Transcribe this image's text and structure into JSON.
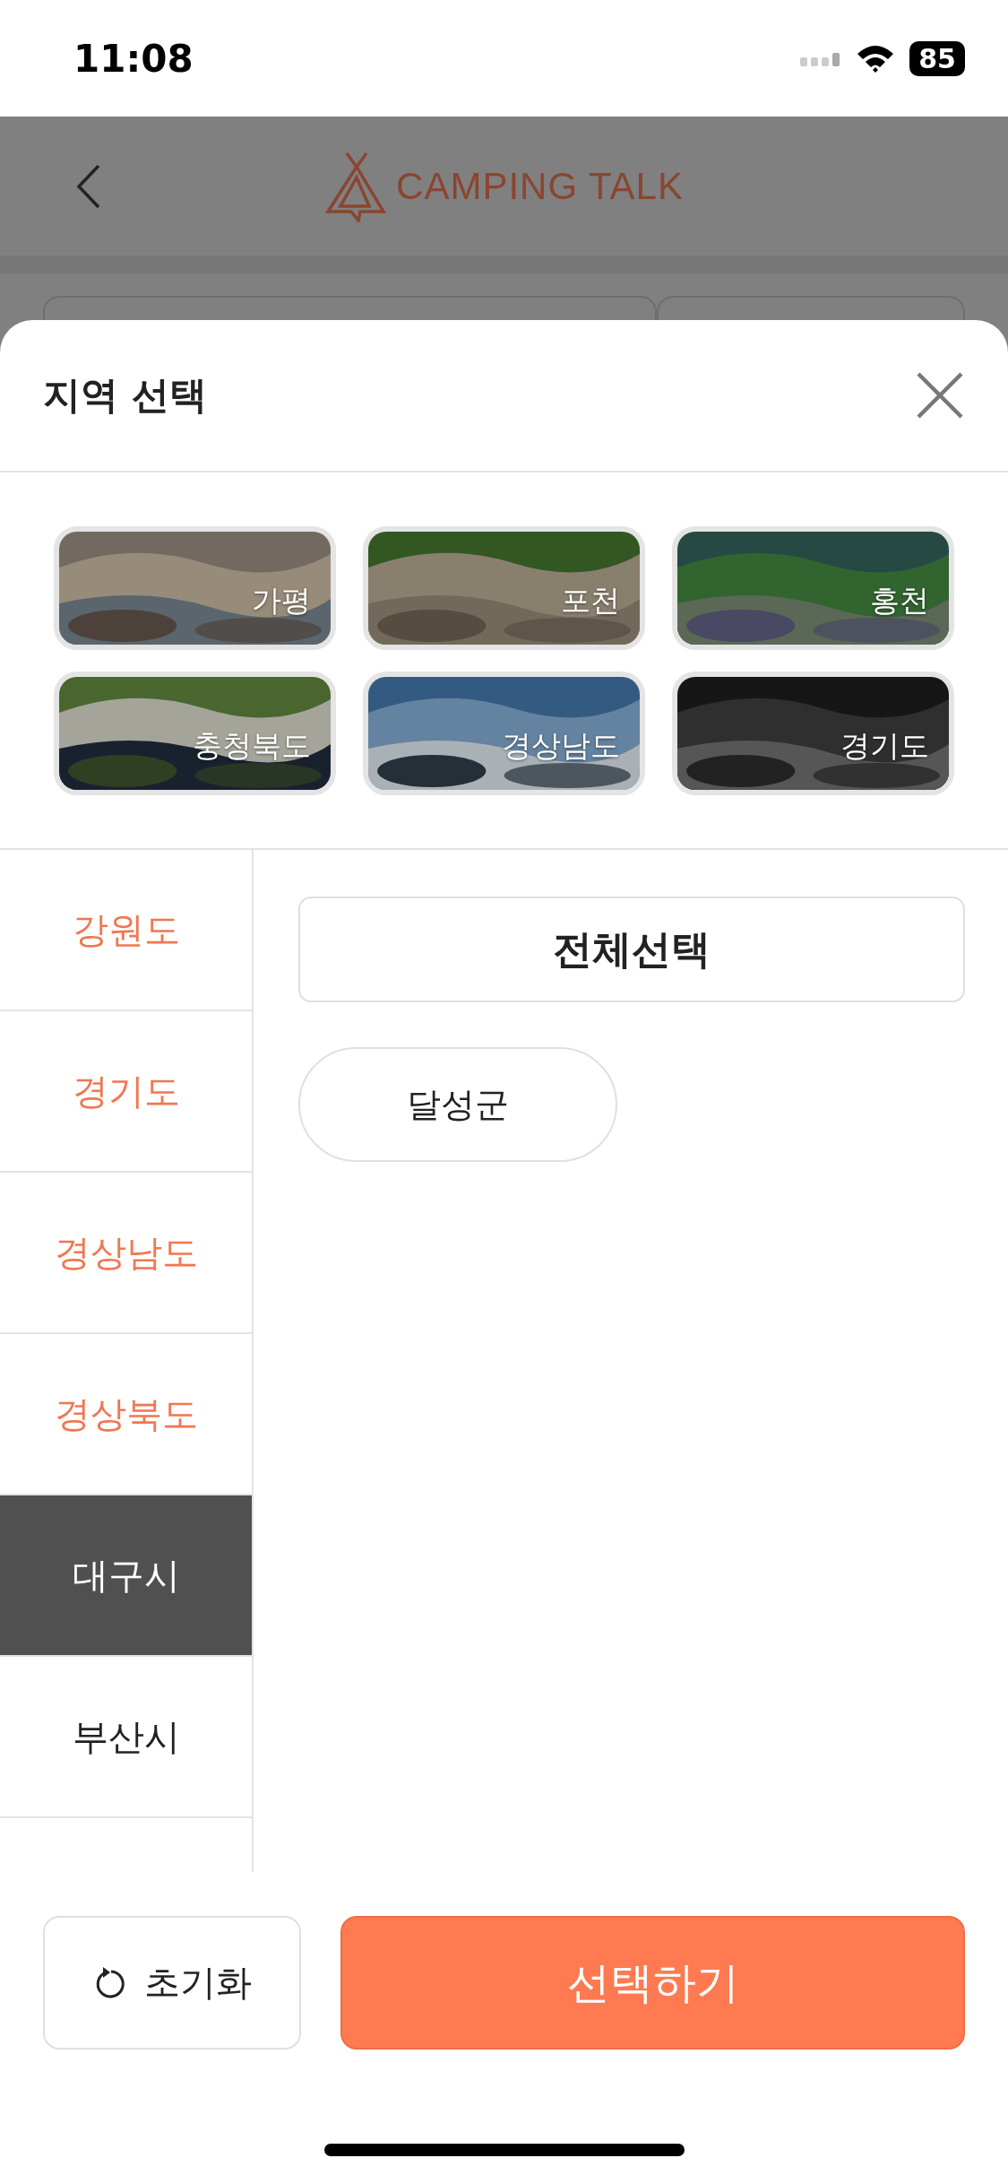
{
  "status_bar": {
    "time": "11:08",
    "battery": "85"
  },
  "header": {
    "logo": "CAMPING TALK"
  },
  "sheet": {
    "title": "지역 선택"
  },
  "featured_regions": [
    {
      "label": "가평",
      "kind": "picture"
    },
    {
      "label": "포천",
      "kind": "picture"
    },
    {
      "label": "홍천",
      "kind": "picture"
    },
    {
      "label": "충청북도",
      "kind": "picture"
    },
    {
      "label": "경상남도",
      "kind": "picture"
    },
    {
      "label": "경기도",
      "kind": "picture"
    }
  ],
  "provinces": [
    {
      "label": "강원도",
      "selected": false,
      "highlighted": true
    },
    {
      "label": "경기도",
      "selected": false,
      "highlighted": true
    },
    {
      "label": "경상남도",
      "selected": false,
      "highlighted": true
    },
    {
      "label": "경상북도",
      "selected": false,
      "highlighted": true
    },
    {
      "label": "대구시",
      "selected": true,
      "highlighted": false
    },
    {
      "label": "부산시",
      "selected": false,
      "highlighted": false
    }
  ],
  "select_all": "전체선택",
  "districts": [
    {
      "label": "달성군",
      "selected": false
    }
  ],
  "buttons": {
    "reset": "초기화",
    "confirm": "선택하기"
  }
}
